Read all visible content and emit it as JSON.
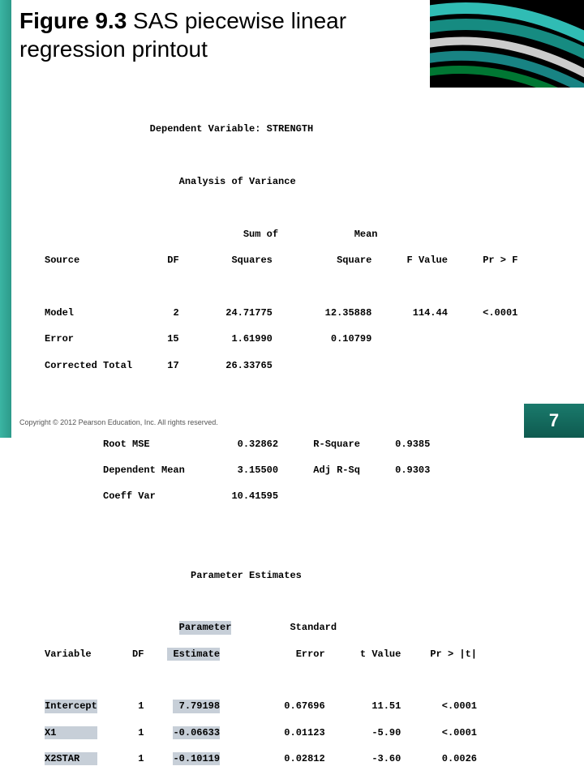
{
  "title_bold": "Figure 9.3",
  "title_rest": "  SAS piecewise linear regression printout",
  "sas": {
    "dep_line": "Dependent Variable: STRENGTH",
    "anova_heading": "Analysis of Variance",
    "hdr_source": "Source",
    "hdr_df": "DF",
    "hdr_ss1": "Sum of",
    "hdr_ss2": "Squares",
    "hdr_ms1": "Mean",
    "hdr_ms2": "Square",
    "hdr_f": "F Value",
    "hdr_pf": "Pr > F",
    "r_model": "Model",
    "r_error": "Error",
    "r_ctotal": "Corrected Total",
    "df_model": "2",
    "df_error": "15",
    "df_ctotal": "17",
    "ss_model": "24.71775",
    "ss_error": "1.61990",
    "ss_ctotal": "26.33765",
    "ms_model": "12.35888",
    "ms_error": "0.10799",
    "f_val": "114.44",
    "pf_val": "<.0001",
    "fit_rmse_l": "Root MSE",
    "fit_rmse_v": "0.32862",
    "fit_rsq_l": "R-Square",
    "fit_rsq_v": "0.9385",
    "fit_dm_l": "Dependent Mean",
    "fit_dm_v": "3.15500",
    "fit_arsq_l": "Adj R-Sq",
    "fit_arsq_v": "0.9303",
    "fit_cv_l": "Coeff Var",
    "fit_cv_v": "10.41595",
    "pe_heading": "Parameter Estimates",
    "pe_var": "Variable",
    "pe_df": "DF",
    "pe_pe1": "Parameter",
    "pe_pe2": "Estimate",
    "pe_se1": "Standard",
    "pe_se2": "Error",
    "pe_t": "t Value",
    "pe_pt": "Pr > |t|",
    "v_int": "Intercept",
    "v_x1": "X1",
    "v_x2": "X2STAR",
    "d_int": "1",
    "d_x1": "1",
    "d_x2": "1",
    "e_int": "7.79198",
    "e_x1": "-0.06633",
    "e_x2": "-0.10119",
    "se_int": "0.67696",
    "se_x1": "0.01123",
    "se_x2": "0.02812",
    "t_int": "11.51",
    "t_x1": "-5.90",
    "t_x2": "-3.60",
    "p_int": "<.0001",
    "p_x1": "<.0001",
    "p_x2": "0.0026"
  },
  "footer": "Copyright © 2012 Pearson Education, Inc. All rights reserved.",
  "page": "7"
}
